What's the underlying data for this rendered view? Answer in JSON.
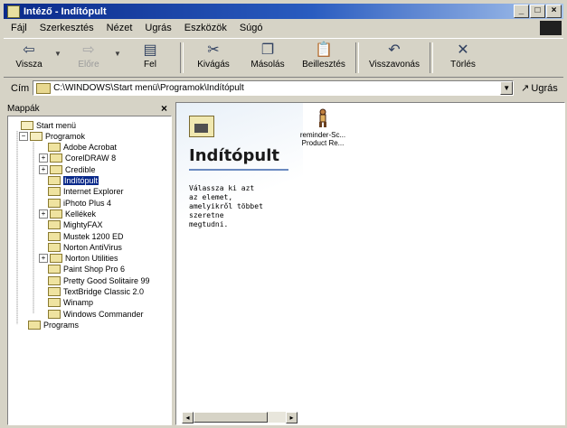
{
  "window": {
    "title": "Intéző - Indítópult"
  },
  "window_buttons": [
    "_",
    "□",
    "×"
  ],
  "menu": [
    "Fájl",
    "Szerkesztés",
    "Nézet",
    "Ugrás",
    "Eszközök",
    "Súgó"
  ],
  "toolbar": {
    "items": [
      {
        "label": "Vissza",
        "icon": "back-arrow-icon",
        "glyph": "⇦",
        "disabled": false
      },
      {
        "label": "Előre",
        "icon": "forward-arrow-icon",
        "glyph": "⇨",
        "disabled": true
      },
      {
        "label": "Fel",
        "icon": "up-folder-icon",
        "glyph": "▤",
        "disabled": false
      },
      {
        "label": "Kivágás",
        "icon": "scissors-icon",
        "glyph": "✂",
        "disabled": false
      },
      {
        "label": "Másolás",
        "icon": "copy-icon",
        "glyph": "❐",
        "disabled": false
      },
      {
        "label": "Beillesztés",
        "icon": "paste-icon",
        "glyph": "📋",
        "disabled": false
      },
      {
        "label": "Visszavonás",
        "icon": "undo-icon",
        "glyph": "↶",
        "disabled": false
      },
      {
        "label": "Törlés",
        "icon": "delete-x-icon",
        "glyph": "✕",
        "disabled": false
      }
    ]
  },
  "address": {
    "label": "Cím",
    "value": "C:\\WINDOWS\\Start menü\\Programok\\Indítópult",
    "go_label": "Ugrás"
  },
  "folders_pane": {
    "title": "Mappák",
    "close": "×",
    "tree": [
      {
        "label": "Start menü",
        "level": 0,
        "expander": "",
        "open": true
      },
      {
        "label": "Programok",
        "level": 1,
        "expander": "−",
        "open": true
      },
      {
        "label": "Adobe Acrobat",
        "level": 2,
        "expander": ""
      },
      {
        "label": "CorelDRAW 8",
        "level": 2,
        "expander": "+"
      },
      {
        "label": "Credible",
        "level": 2,
        "expander": "+"
      },
      {
        "label": "Indítópult",
        "level": 2,
        "expander": "",
        "selected": true
      },
      {
        "label": "Internet Explorer",
        "level": 2,
        "expander": ""
      },
      {
        "label": "iPhoto Plus 4",
        "level": 2,
        "expander": ""
      },
      {
        "label": "Kellékek",
        "level": 2,
        "expander": "+"
      },
      {
        "label": "MightyFAX",
        "level": 2,
        "expander": ""
      },
      {
        "label": "Mustek 1200  ED",
        "level": 2,
        "expander": ""
      },
      {
        "label": "Norton AntiVirus",
        "level": 2,
        "expander": ""
      },
      {
        "label": "Norton Utilities",
        "level": 2,
        "expander": "+"
      },
      {
        "label": "Paint Shop Pro 6",
        "level": 2,
        "expander": ""
      },
      {
        "label": "Pretty Good Solitaire 99",
        "level": 2,
        "expander": ""
      },
      {
        "label": "TextBridge Classic 2.0",
        "level": 2,
        "expander": ""
      },
      {
        "label": "Winamp",
        "level": 2,
        "expander": ""
      },
      {
        "label": "Windows Commander",
        "level": 2,
        "expander": ""
      },
      {
        "label": "Programs",
        "level": 1,
        "expander": ""
      }
    ]
  },
  "content": {
    "heading": "Indítópult",
    "description": "Válassza ki azt\naz elemet,\namelyikről többet\nszeretne\nmegtudni.",
    "items": [
      {
        "label": "reminder-Sc...\nProduct Re...",
        "icon": "shortcut-figure-icon"
      }
    ]
  },
  "scroll": {
    "left": "◂",
    "right": "▸"
  }
}
